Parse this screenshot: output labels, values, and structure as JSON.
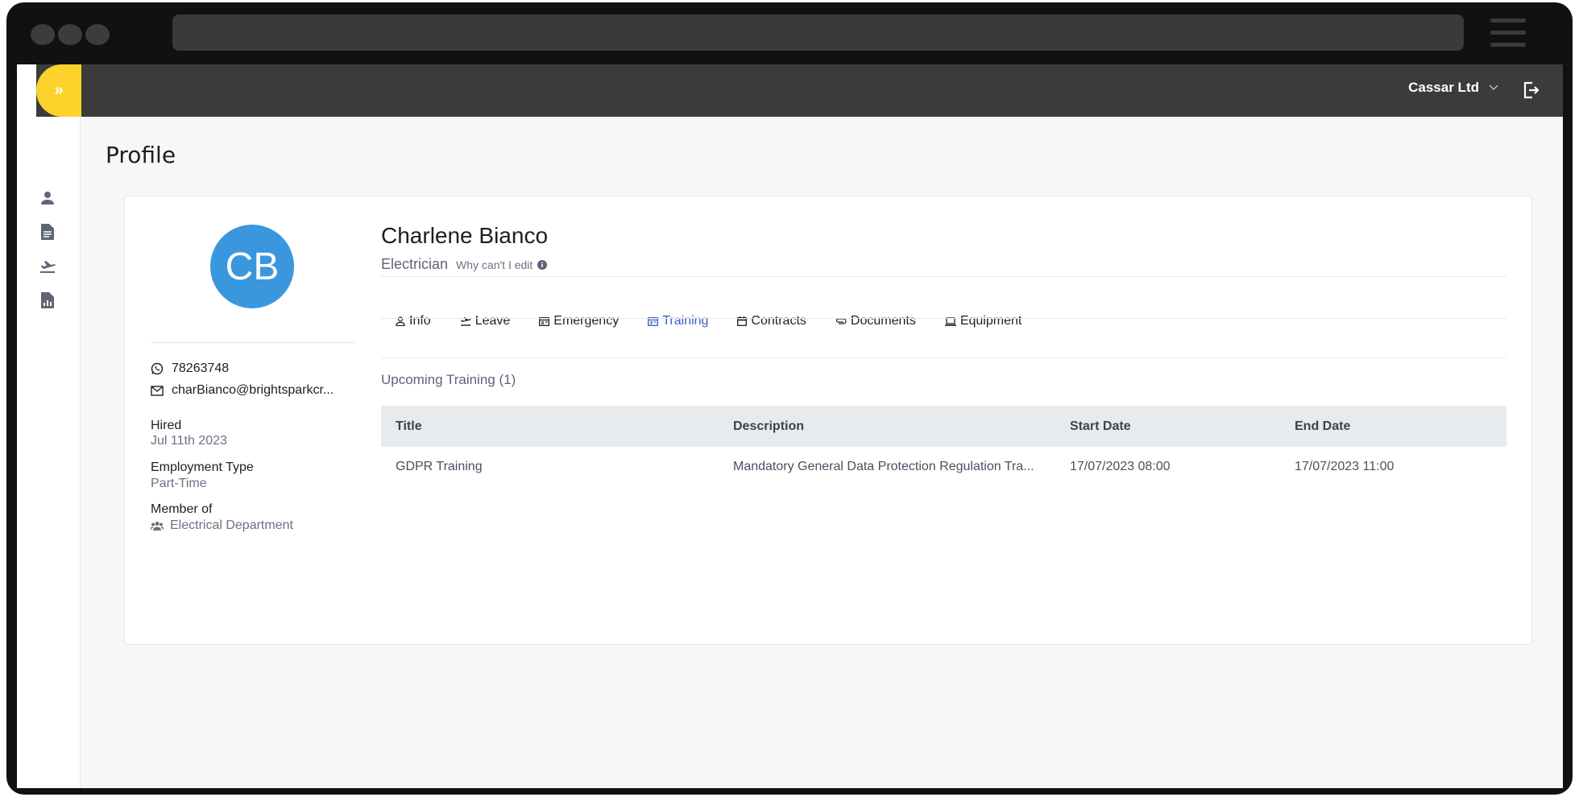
{
  "header": {
    "company": "Cassar Ltd"
  },
  "page": {
    "title": "Profile"
  },
  "profile": {
    "initials": "CB",
    "name": "Charlene Bianco",
    "role": "Electrician",
    "why_edit": "Why can't I edit",
    "phone": "78263748",
    "email": "charBianco@brightsparkcr...",
    "hired_label": "Hired",
    "hired_value": "Jul 11th 2023",
    "employment_label": "Employment Type",
    "employment_value": "Part-Time",
    "member_label": "Member of",
    "member_value": "Electrical Department"
  },
  "tabs": [
    {
      "label": "Info",
      "icon": "user-icon"
    },
    {
      "label": "Leave",
      "icon": "plane-icon"
    },
    {
      "label": "Emergency",
      "icon": "card-icon"
    },
    {
      "label": "Training",
      "icon": "card-icon",
      "active": true
    },
    {
      "label": "Contracts",
      "icon": "calendar-icon"
    },
    {
      "label": "Documents",
      "icon": "paperclip-icon"
    },
    {
      "label": "Equipment",
      "icon": "laptop-icon"
    }
  ],
  "training": {
    "section_title": "Upcoming Training (1)",
    "columns": [
      "Title",
      "Description",
      "Start Date",
      "End Date"
    ],
    "rows": [
      [
        "GDPR Training",
        "Mandatory General Data Protection Regulation Tra...",
        "17/07/2023 08:00",
        "17/07/2023 11:00"
      ]
    ]
  },
  "colors": {
    "accent": "#fdd22b",
    "active_tab": "#3b5cc4",
    "avatar": "#3a97dd"
  }
}
